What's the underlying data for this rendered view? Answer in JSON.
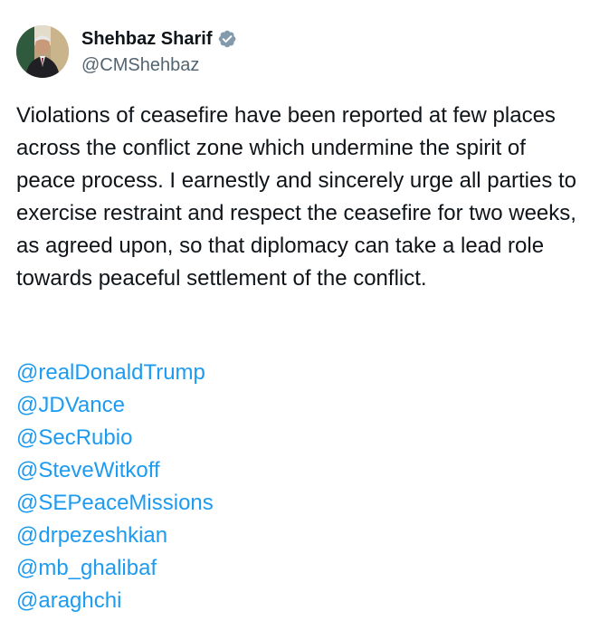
{
  "author": {
    "display_name": "Shehbaz Sharif",
    "handle": "@CMShehbaz",
    "verified_icon": "verified-badge-gray",
    "avatar_icon": "profile-photo"
  },
  "tweet": {
    "text": "Violations of ceasefire have been reported at few places across the conflict zone which undermine the spirit of peace process. I earnestly and sincerely urge all parties to exercise restraint and respect the ceasefire for two weeks, as agreed upon, so that diplomacy can take a lead role towards peaceful settlement of the conflict.",
    "mentions": [
      "@realDonaldTrump",
      "@JDVance",
      "@SecRubio",
      "@SteveWitkoff",
      "@SEPeaceMissions",
      "@drpezeshkian",
      "@mb_ghalibaf",
      "@araghchi"
    ]
  },
  "colors": {
    "text": "#0f1419",
    "secondary_text": "#536471",
    "link": "#1d9bf0",
    "badge": "#829aab"
  }
}
